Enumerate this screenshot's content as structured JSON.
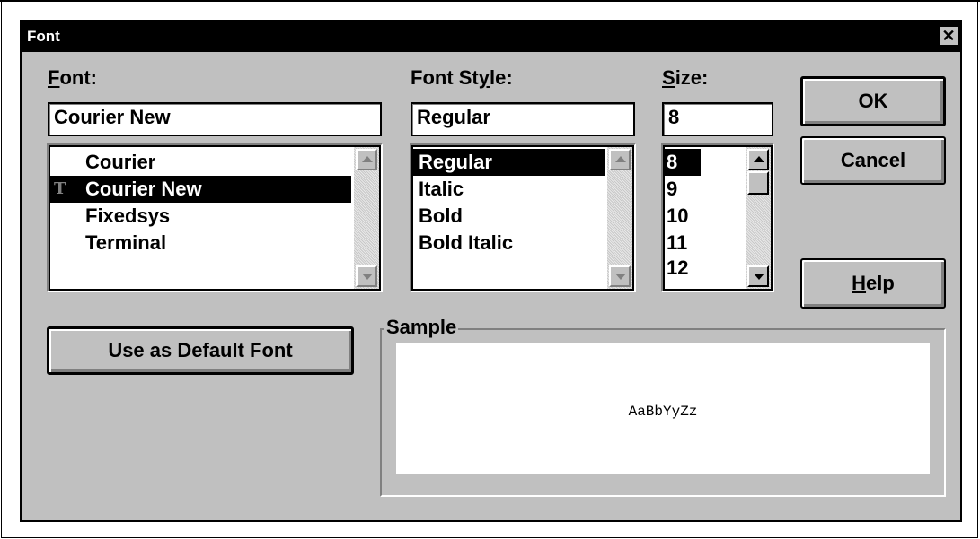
{
  "dialog": {
    "title": "Font",
    "close_label": "✕"
  },
  "font": {
    "label_mnemonic": "F",
    "label_rest": "ont:",
    "value": "Courier New",
    "items": [
      "Courier",
      "Courier New",
      "Fixedsys",
      "Terminal"
    ],
    "selected_index": 1,
    "truetype_icon": "T"
  },
  "style": {
    "label_pre": "Font St",
    "label_mnemonic": "y",
    "label_rest": "le:",
    "value": "Regular",
    "items": [
      "Regular",
      "Italic",
      "Bold",
      "Bold Italic"
    ],
    "selected_index": 0
  },
  "size": {
    "label_mnemonic": "S",
    "label_rest": "ize:",
    "value": "8",
    "items": [
      "8",
      "9",
      "10",
      "11",
      "12"
    ],
    "selected_index": 0
  },
  "buttons": {
    "ok": "OK",
    "cancel": "Cancel",
    "help_mnemonic": "H",
    "help_rest": "elp",
    "default_font": "Use as Default Font"
  },
  "sample": {
    "legend": "Sample",
    "text": "AaBbYyZz"
  },
  "icons": {
    "close": "close-icon",
    "scroll_up": "scroll-up-arrow-icon",
    "scroll_down": "scroll-down-arrow-icon",
    "truetype": "truetype-icon"
  }
}
